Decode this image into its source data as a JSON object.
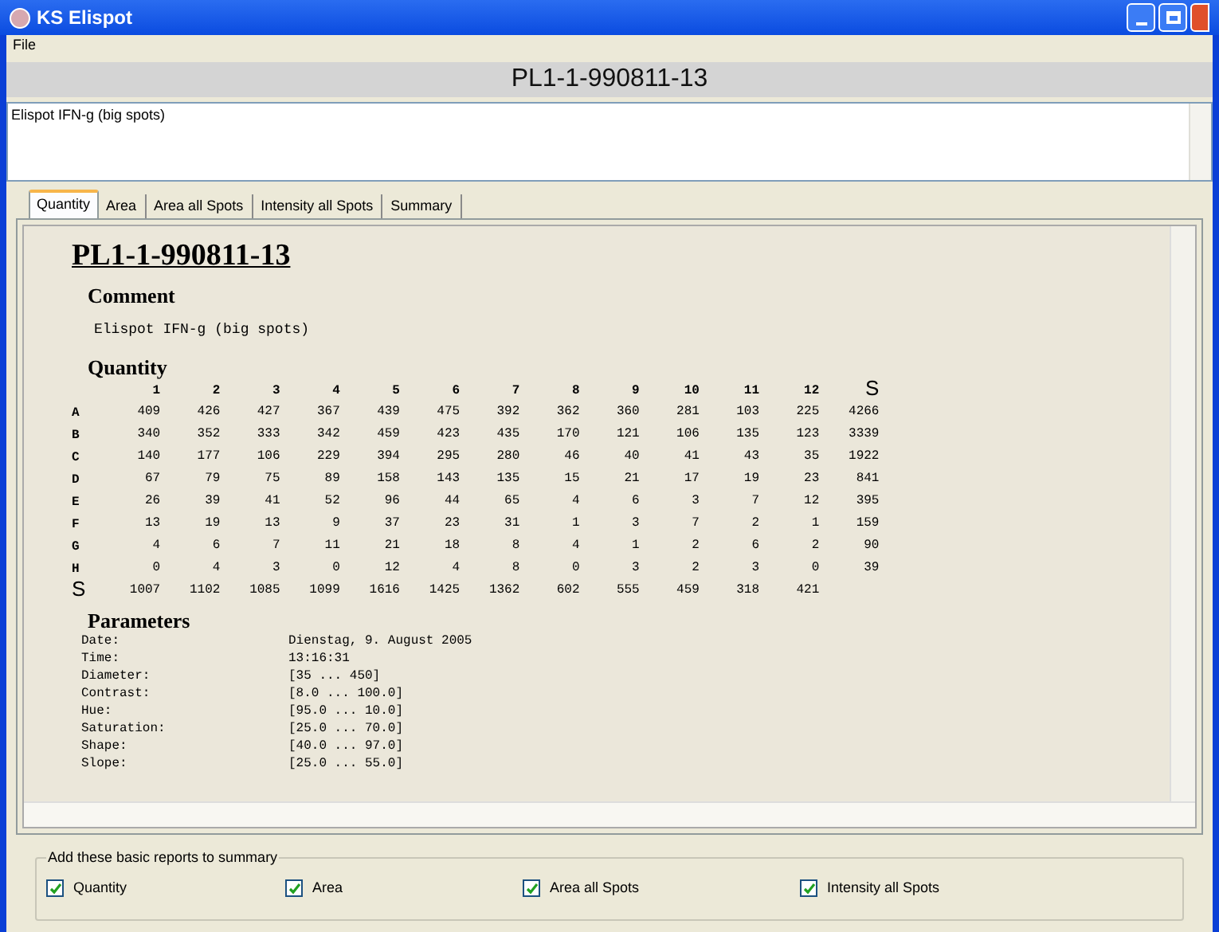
{
  "window": {
    "title": "KS Elispot"
  },
  "menu": [
    "File"
  ],
  "header_title": "PL1-1-990811-13",
  "comment_field": {
    "value": "Elispot IFN-g (big spots)"
  },
  "tabs": [
    {
      "label": "Quantity",
      "selected": true
    },
    {
      "label": "Area",
      "selected": false
    },
    {
      "label": "Area all Spots",
      "selected": false
    },
    {
      "label": "Intensity all Spots",
      "selected": false
    },
    {
      "label": "Summary",
      "selected": false
    }
  ],
  "report": {
    "title": "PL1-1-990811-13",
    "comment_heading": "Comment",
    "comment": "Elispot IFN-g (big spots)",
    "quantity_heading": "Quantity",
    "columns": [
      "1",
      "2",
      "3",
      "4",
      "5",
      "6",
      "7",
      "8",
      "9",
      "10",
      "11",
      "12",
      "S"
    ],
    "rows": [
      {
        "label": "A",
        "values": [
          "409",
          "426",
          "427",
          "367",
          "439",
          "475",
          "392",
          "362",
          "360",
          "281",
          "103",
          "225",
          "4266"
        ]
      },
      {
        "label": "B",
        "values": [
          "340",
          "352",
          "333",
          "342",
          "459",
          "423",
          "435",
          "170",
          "121",
          "106",
          "135",
          "123",
          "3339"
        ]
      },
      {
        "label": "C",
        "values": [
          "140",
          "177",
          "106",
          "229",
          "394",
          "295",
          "280",
          "46",
          "40",
          "41",
          "43",
          "35",
          "1922"
        ]
      },
      {
        "label": "D",
        "values": [
          "67",
          "79",
          "75",
          "89",
          "158",
          "143",
          "135",
          "15",
          "21",
          "17",
          "19",
          "23",
          "841"
        ]
      },
      {
        "label": "E",
        "values": [
          "26",
          "39",
          "41",
          "52",
          "96",
          "44",
          "65",
          "4",
          "6",
          "3",
          "7",
          "12",
          "395"
        ]
      },
      {
        "label": "F",
        "values": [
          "13",
          "19",
          "13",
          "9",
          "37",
          "23",
          "31",
          "1",
          "3",
          "7",
          "2",
          "1",
          "159"
        ]
      },
      {
        "label": "G",
        "values": [
          "4",
          "6",
          "7",
          "11",
          "21",
          "18",
          "8",
          "4",
          "1",
          "2",
          "6",
          "2",
          "90"
        ]
      },
      {
        "label": "H",
        "values": [
          "0",
          "4",
          "3",
          "0",
          "12",
          "4",
          "8",
          "0",
          "3",
          "2",
          "3",
          "0",
          "39"
        ]
      }
    ],
    "sum_row": {
      "label": "S",
      "values": [
        "1007",
        "1102",
        "1085",
        "1099",
        "1616",
        "1425",
        "1362",
        "602",
        "555",
        "459",
        "318",
        "421"
      ]
    },
    "parameters_heading": "Parameters",
    "parameters": [
      {
        "name": "Date:",
        "value": "Dienstag, 9. August 2005"
      },
      {
        "name": "Time:",
        "value": "13:16:31"
      },
      {
        "name": "Diameter:",
        "value": "[35 ... 450]"
      },
      {
        "name": "Contrast:",
        "value": "[8.0 ... 100.0]"
      },
      {
        "name": "Hue:",
        "value": "[95.0 ... 10.0]"
      },
      {
        "name": "Saturation:",
        "value": "[25.0 ... 70.0]"
      },
      {
        "name": "Shape:",
        "value": "[40.0 ... 97.0]"
      },
      {
        "name": "Slope:",
        "value": "[25.0 ... 55.0]"
      }
    ]
  },
  "summary_group": {
    "title": "Add these basic reports to summary",
    "options": [
      {
        "label": "Quantity",
        "checked": true
      },
      {
        "label": "Area",
        "checked": true
      },
      {
        "label": "Area all Spots",
        "checked": true
      },
      {
        "label": "Intensity all Spots",
        "checked": true
      }
    ]
  }
}
